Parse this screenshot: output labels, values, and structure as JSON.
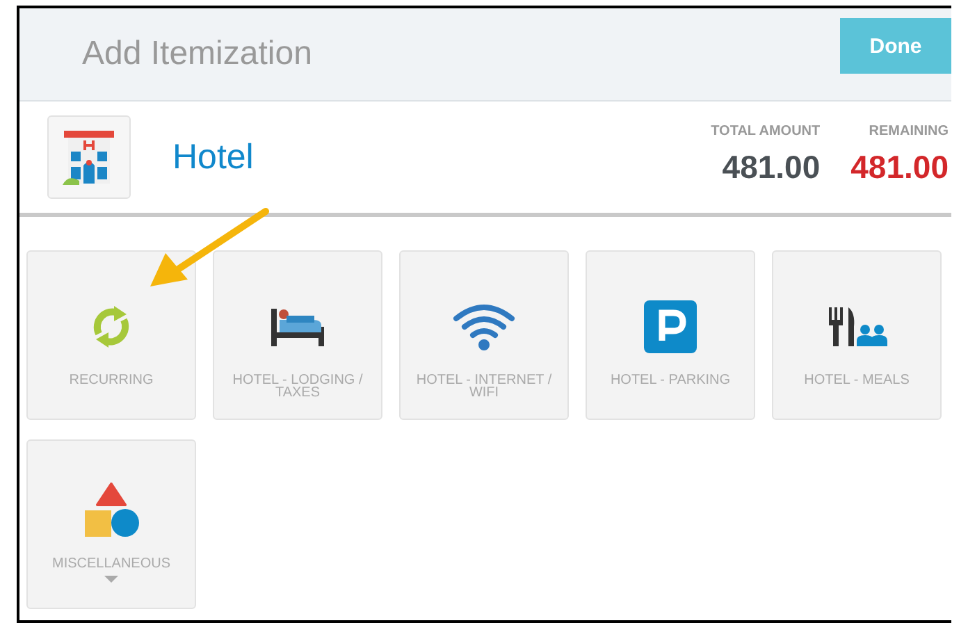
{
  "header": {
    "title": "Add Itemization",
    "done_button": "Done"
  },
  "expense": {
    "type": "Hotel",
    "total_label": "TOTAL AMOUNT",
    "total": "481.00",
    "remaining_label": "REMAINING",
    "remaining": "481.00"
  },
  "tiles": [
    {
      "kind": "recurring",
      "label": "RECURRING",
      "expandable": false
    },
    {
      "kind": "lodging",
      "label": "HOTEL - LODGING / TAXES",
      "expandable": false
    },
    {
      "kind": "wifi",
      "label": "HOTEL - INTERNET / WIFI",
      "expandable": false
    },
    {
      "kind": "parking",
      "label": "HOTEL - PARKING",
      "expandable": false
    },
    {
      "kind": "meals",
      "label": "HOTEL - MEALS",
      "expandable": false
    },
    {
      "kind": "misc",
      "label": "MISCELLANEOUS",
      "expandable": true
    }
  ]
}
